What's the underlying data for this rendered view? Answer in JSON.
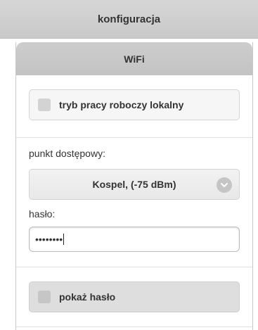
{
  "header": {
    "title": "konfiguracja"
  },
  "panel": {
    "title": "WiFi",
    "local_mode": {
      "label": "tryb pracy roboczy lokalny",
      "checked": false
    },
    "access_point": {
      "label": "punkt dostępowy:",
      "selected": "Kospel, (-75 dBm)"
    },
    "password": {
      "label": "hasło:",
      "value_masked": "••••••••"
    },
    "show_password": {
      "label": "pokaż hasło",
      "checked": false
    }
  },
  "icons": {
    "select_chevron": "chevron-down-icon"
  }
}
